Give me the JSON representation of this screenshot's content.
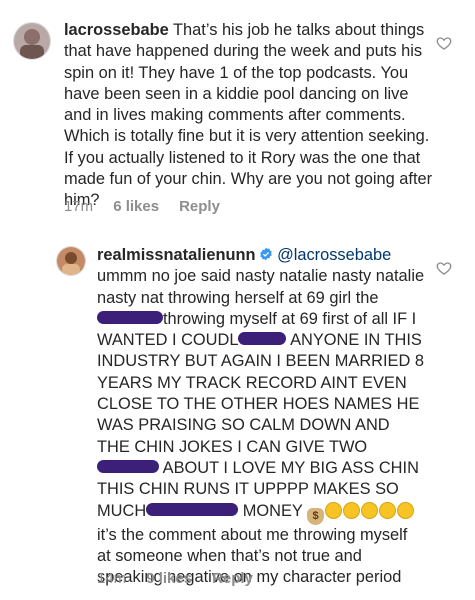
{
  "comments": [
    {
      "username": "lacrossebabe",
      "text": "That’s his job he talks about things that have happened during the week and puts his spin on it! They have 1 of the top podcasts. You have been seen in a kiddie pool dancing on live and in lives making comments after comments. Which is totally fine but it is very attention seeking. If you actually listened to it Rory was the one that made fun of your chin. Why are you not going after him?",
      "time": "17m",
      "likes": "6 likes",
      "reply": "Reply"
    },
    {
      "username": "realmissnatalienunn",
      "mention": "@lacrossebabe",
      "text_parts": [
        "ummm no joe said nasty natalie nasty natalie nasty nat throwing herself at 69 girl the",
        "throwing myself at 69 first of all IF I WANTED I COUDL",
        " ANYONE IN THIS INDUSTRY BUT AGAIN I BEEN MARRIED 8 YEARS MY TRACK RECORD AINT EVEN CLOSE TO THE OTHER HOES NAMES HE WAS PRAISING SO CALM DOWN AND THE CHIN JOKES I CAN GIVE TWO",
        " ABOUT I LOVE MY BIG ASS CHIN THIS CHIN RUNS IT UPPPP MAKES SO MUCH",
        " MONEY",
        " it’s the comment about me throwing myself at someone when that’s not true and speaking negative on my character period"
      ],
      "time": "14m",
      "likes": "9 likes",
      "reply": "Reply"
    }
  ],
  "icons": {
    "heart": "heart-outline-icon",
    "verified": "verified-badge-icon",
    "laughing": "laughing-emoji-icon",
    "money_bag": "money-bag-emoji-icon"
  },
  "colors": {
    "text": "#262626",
    "meta": "#8e8e8e",
    "mention": "#00376b",
    "verified": "#3897f0",
    "redaction": "#3b1f78"
  }
}
